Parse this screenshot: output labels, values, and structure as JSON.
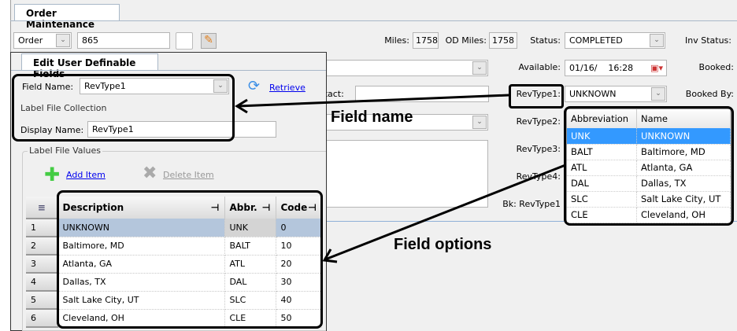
{
  "main_tab": "Order Maintenance",
  "order": {
    "type": "Order",
    "number": "865"
  },
  "miles": {
    "miles_label": "Miles:",
    "miles": "1758",
    "od_label": "OD Miles:",
    "od": "1758"
  },
  "status": {
    "label": "Status:",
    "value": "COMPLETED",
    "inv_label": "Inv Status:"
  },
  "available": {
    "label": "Available:",
    "value": "01/16/",
    "time": "16:28",
    "booked_label": "Booked:"
  },
  "revtype1": {
    "label": "RevType1:",
    "value": "UNKNOWN",
    "booked_by_label": "Booked By:"
  },
  "revtype2_label": "RevType2:",
  "revtype3_label": "RevType3:",
  "revtype4_label": "RevType4:",
  "bk_revtype1_label": "Bk: RevType1",
  "contact_label": "ontact:",
  "dropdown": {
    "headers": [
      "Abbreviation",
      "Name"
    ],
    "rows": [
      [
        "UNK",
        "UNKNOWN"
      ],
      [
        "BALT",
        "Baltimore, MD"
      ],
      [
        "ATL",
        "Atlanta, GA"
      ],
      [
        "DAL",
        "Dallas, TX"
      ],
      [
        "SLC",
        "Salt Lake City, UT"
      ],
      [
        "CLE",
        "Cleveland, OH"
      ]
    ],
    "selected_color": "#3399ff"
  },
  "dialog": {
    "tab": "Edit User Definable Fields",
    "field_name_label": "Field Name:",
    "field_name": "RevType1",
    "retrieve": "Retrieve",
    "collection_label": "Label File Collection",
    "display_name_label": "Display Name:",
    "display_name": "RevType1",
    "values_label": "Label File Values",
    "add_item": "Add Item",
    "delete_item": "Delete Item",
    "grid": {
      "headers": [
        "Description",
        "Abbr.",
        "Code"
      ],
      "rows": [
        {
          "n": "1",
          "desc": "UNKNOWN",
          "abbr": "UNK",
          "code": "0"
        },
        {
          "n": "2",
          "desc": "Baltimore, MD",
          "abbr": "BALT",
          "code": "10"
        },
        {
          "n": "3",
          "desc": "Atlanta, GA",
          "abbr": "ATL",
          "code": "20"
        },
        {
          "n": "4",
          "desc": "Dallas, TX",
          "abbr": "DAL",
          "code": "30"
        },
        {
          "n": "5",
          "desc": "Salt Lake City, UT",
          "abbr": "SLC",
          "code": "40"
        },
        {
          "n": "6",
          "desc": "Cleveland, OH",
          "abbr": "CLE",
          "code": "50"
        }
      ]
    }
  },
  "annotations": {
    "field_name": "Field name",
    "field_options": "Field options"
  }
}
